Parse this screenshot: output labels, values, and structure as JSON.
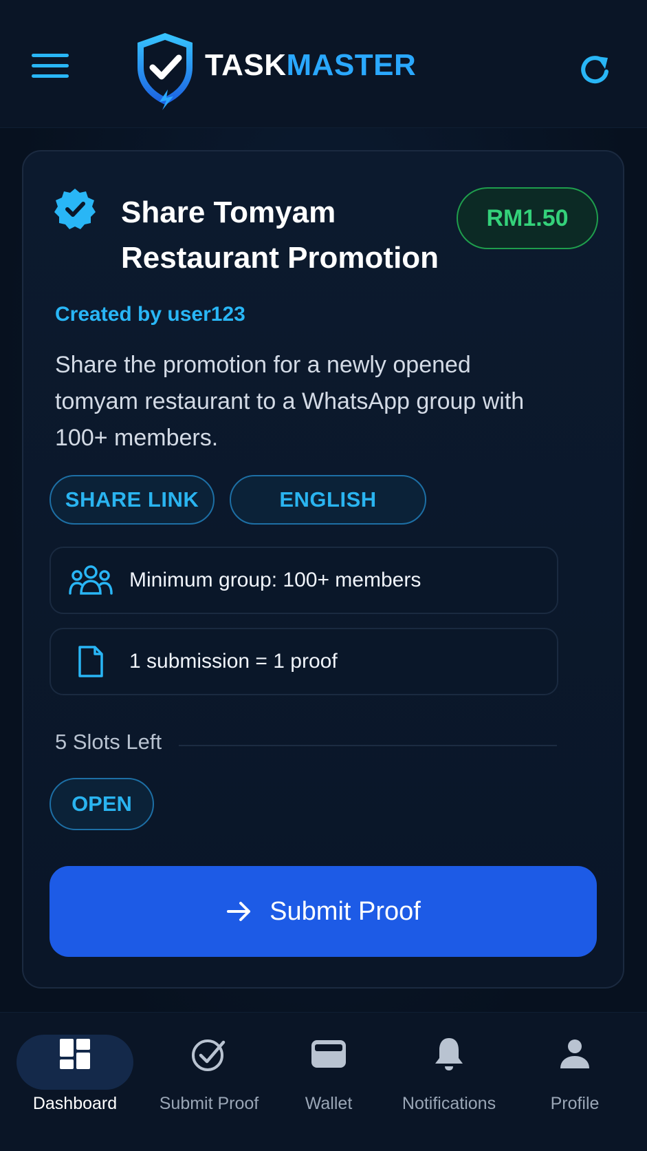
{
  "header": {
    "brand_part1": "TASK",
    "brand_part2": "MASTER"
  },
  "task": {
    "title_line1": "Share Tomyam",
    "title_line2": "Restaurant Promotion",
    "reward": "RM1.50",
    "creator": "Created by user123",
    "description": "Share the promotion for a newly opened tomyam restaurant to a WhatsApp group with 100+ members.",
    "tags": [
      "SHARE LINK",
      "ENGLISH"
    ],
    "requirements": [
      {
        "icon": "users-icon",
        "text": "Minimum group: 100+ members"
      },
      {
        "icon": "document-icon",
        "text": "1 submission = 1 proof"
      }
    ],
    "slots_left": "5 Slots Left",
    "status": "OPEN",
    "submit_label": "Submit Proof"
  },
  "bottom_nav": {
    "items": [
      {
        "label": "Dashboard",
        "icon": "dashboard-icon",
        "active": true
      },
      {
        "label": "Submit Proof",
        "icon": "check-circle-icon",
        "active": false
      },
      {
        "label": "Wallet",
        "icon": "wallet-icon",
        "active": false
      },
      {
        "label": "Notifications",
        "icon": "bell-icon",
        "active": false
      },
      {
        "label": "Profile",
        "icon": "user-icon",
        "active": false
      }
    ]
  },
  "colors": {
    "accent": "#29b6f6",
    "primary_button": "#1d5be6",
    "reward_green": "#34d17a",
    "background": "#07111f"
  }
}
